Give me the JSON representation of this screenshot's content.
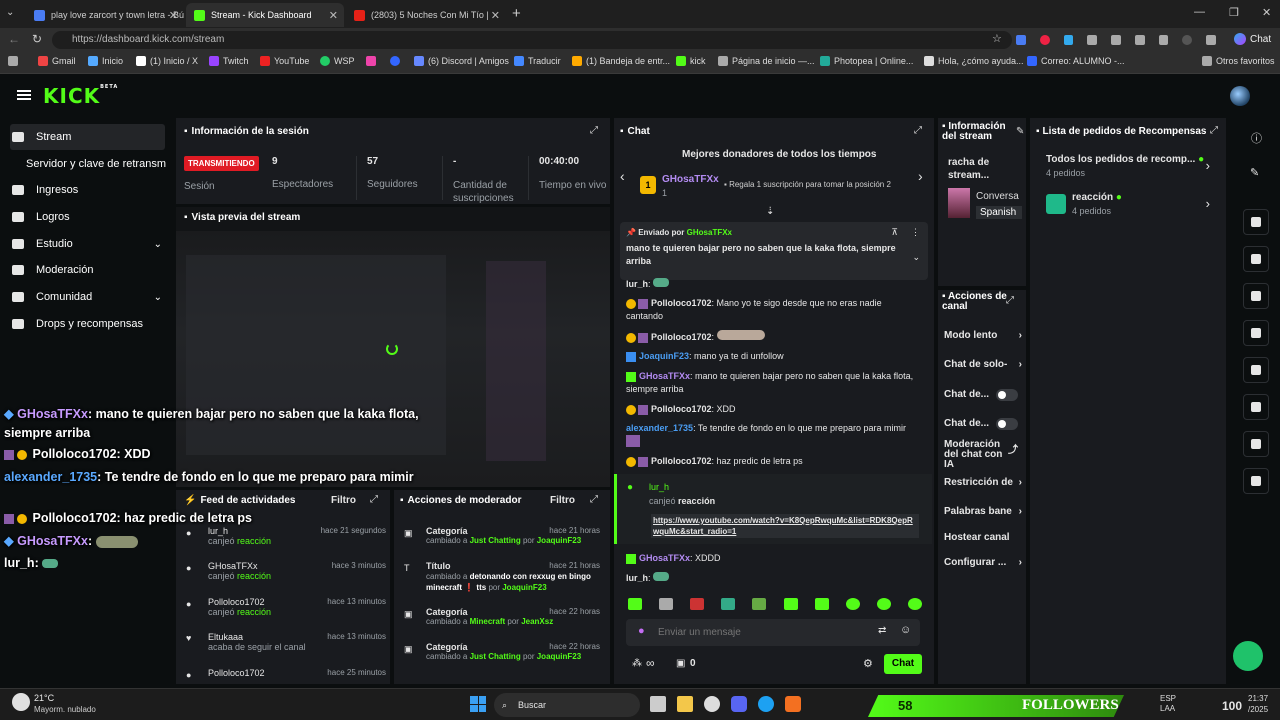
{
  "browser": {
    "tabs": [
      {
        "title": "play love zarcort y town letra - Bú",
        "color": "#4a7cf3"
      },
      {
        "title": "Stream - Kick Dashboard",
        "color": "#53fc18"
      },
      {
        "title": "(2803) 5 Noches Con Mi Tío |",
        "color": "#e62117"
      }
    ],
    "url": "https://dashboard.kick.com/stream",
    "chat_button": "Chat",
    "bookmarks": [
      "Gmail",
      "Inicio",
      "(1) Inicio / X",
      "Twitch",
      "YouTube",
      "WSP",
      "(6) Discord | Amigos",
      "Traducir",
      "(1) Bandeja de entr...",
      "kick",
      "Página de inicio —...",
      "Photopea | Online...",
      "Hola, ¿cómo ayuda...",
      "Correo: ALUMNO -...",
      "Otros favoritos"
    ]
  },
  "app": {
    "logo": "KICK",
    "logo_beta": "BETA",
    "nav": [
      {
        "label": "Stream",
        "icon": "stream-icon"
      },
      {
        "label": "Servidor y clave de retransm",
        "icon": ""
      },
      {
        "label": "Ingresos",
        "icon": "revenue-icon"
      },
      {
        "label": "Logros",
        "icon": "trophy-icon"
      },
      {
        "label": "Estudio",
        "icon": "studio-icon"
      },
      {
        "label": "Moderación",
        "icon": "moderation-icon"
      },
      {
        "label": "Comunidad",
        "icon": "community-icon"
      },
      {
        "label": "Drops y recompensas",
        "icon": "drops-icon"
      }
    ]
  },
  "session": {
    "title": "Información de la sesión",
    "status_badge": "TRANSMITIENDO",
    "status_label": "Sesión",
    "stats": [
      {
        "value": "9",
        "label": "Espectadores"
      },
      {
        "value": "57",
        "label": "Seguidores"
      },
      {
        "value": "-",
        "label": "Cantidad de suscripciones"
      },
      {
        "value": "00:40:00",
        "label": "Tiempo en vivo"
      }
    ]
  },
  "preview": {
    "title": "Vista previa del stream"
  },
  "feed": {
    "title": "Feed de actividades",
    "filter": "Filtro",
    "items": [
      {
        "user": "lur_h",
        "action": "canjeó",
        "target": "reacción",
        "time": "hace 21 segundos"
      },
      {
        "user": "GHosaTFXx",
        "action": "canjeó",
        "target": "reacción",
        "time": "hace 3 minutos"
      },
      {
        "user": "Polloloco1702",
        "action": "canjeó",
        "target": "reacción",
        "time": "hace 13 minutos"
      },
      {
        "user": "Eltukaaa",
        "action": "acaba de seguir el canal",
        "target": "",
        "time": "hace 13 minutos"
      },
      {
        "user": "Polloloco1702",
        "action": "",
        "target": "",
        "time": "hace 25 minutos"
      }
    ]
  },
  "modactions": {
    "title": "Acciones de moderador",
    "filter": "Filtro",
    "items": [
      {
        "field": "Categoría",
        "prefix": "cambiado a",
        "value": "Just Chatting",
        "by": "por",
        "user": "JoaquinF23",
        "time": "hace 21 horas"
      },
      {
        "field": "Título",
        "prefix": "cambiado a",
        "value": "detonando con rexxug en bingo minecraft ❗ tts",
        "by": "por",
        "user": "JoaquinF23",
        "time": "hace 21 horas"
      },
      {
        "field": "Categoría",
        "prefix": "cambiado a",
        "value": "Minecraft",
        "by": "por",
        "user": "JeanXsz",
        "time": "hace 22 horas"
      },
      {
        "field": "Categoría",
        "prefix": "cambiado a",
        "value": "Just Chatting",
        "by": "por",
        "user": "JoaquinF23",
        "time": "hace 22 horas"
      }
    ]
  },
  "chat": {
    "title": "Chat",
    "top_donors": "Mejores donadores de todos los tiempos",
    "donor_name": "GHosaTFXx",
    "donor_count": "1",
    "donor_cta": "Regala 1 suscripción para tomar la posición 2",
    "pinned_by_label": "Enviado por",
    "pinned_user": "GHosaTFXx",
    "pinned_text": "mano te quieren bajar pero no saben que la kaka flota, siempre arriba",
    "messages": [
      {
        "user": "lur_h",
        "text": "",
        "color": "#e6e6e6"
      },
      {
        "user": "Polloloco1702",
        "text": "Mano yo te sigo desde que no eras nadie cantando",
        "color": "#e6e6e6"
      },
      {
        "user": "Polloloco1702",
        "text": "",
        "color": "#e6e6e6"
      },
      {
        "user": "JoaquinF23",
        "text": "mano ya te di unfollow",
        "color": "#4a9df3"
      },
      {
        "user": "GHosaTFXx",
        "text": "mano te quieren bajar pero no saben que la kaka flota, siempre arriba",
        "color": "#b48cf3"
      },
      {
        "user": "Polloloco1702",
        "text": "XDD",
        "color": "#e6e6e6"
      },
      {
        "user": "alexander_1735",
        "text": "Te tendre de fondo en lo que me preparo para mimir",
        "color": "#4a9df3"
      },
      {
        "user": "Polloloco1702",
        "text": "haz predic de letra ps",
        "color": "#e6e6e6"
      }
    ],
    "redeem_user": "lur_h",
    "redeem_action": "canjeó",
    "redeem_target": "reacción",
    "redeem_link": "https://www.youtube.com/watch?v=K8QepRwquMc&list=RDK8QepRwquMc&start_radio=1",
    "last_messages": [
      {
        "user": "GHosaTFXx",
        "text": "XDDD"
      },
      {
        "user": "lur_h",
        "text": ""
      }
    ],
    "input_placeholder": "Enviar un mensaje",
    "infinite": "∞",
    "count": "0",
    "send_button": "Chat"
  },
  "stream_info": {
    "title": "Información del stream",
    "racha": "racha de stream...",
    "category": "Conversa",
    "language": "Spanish"
  },
  "rewards": {
    "title": "Lista de pedidos de Recompensas",
    "all_label": "Todos los pedidos de recomp...",
    "all_count": "4 pedidos",
    "item_label": "reacción",
    "item_count": "4 pedidos"
  },
  "channel_actions": {
    "title": "Acciones de canal",
    "items": [
      "Modo lento",
      "Chat de solo-",
      "Chat de...",
      "Chat de...",
      "Moderación del chat con IA",
      "Restricción de",
      "Palabras bane",
      "Hostear canal",
      "Configurar ..."
    ]
  },
  "overlay": [
    {
      "user": "GHosaTFXx",
      "text": ": mano te quieren bajar pero no saben que la kaka flota,"
    },
    {
      "user": "",
      "text": "siempre arriba"
    },
    {
      "user": "Polloloco1702",
      "text": ": XDD"
    },
    {
      "user": "alexander_1735",
      "text": ": Te tendre de fondo en lo que me preparo para mimir"
    },
    {
      "user": "Polloloco1702",
      "text": ": haz predic de letra ps"
    },
    {
      "user": "GHosaTFXx",
      "text": ":"
    },
    {
      "user": "lur_h",
      "text": ":"
    }
  ],
  "taskbar": {
    "weather_temp": "21°C",
    "weather_desc": "Mayorm. nublado",
    "search": "Buscar",
    "followers_count": "58",
    "followers_label": "FOLLOWERS",
    "lang": "ESP",
    "lang2": "LAA",
    "battery": "100",
    "time": "21:37",
    "date": "/2025"
  }
}
